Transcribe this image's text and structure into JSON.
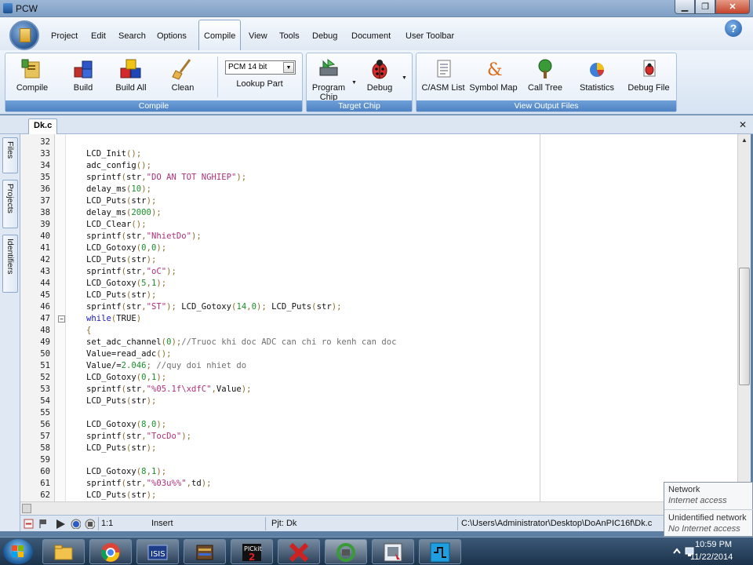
{
  "window": {
    "title": "PCW"
  },
  "menu": {
    "items": [
      "Project",
      "Edit",
      "Search",
      "Options",
      "Compile",
      "View",
      "Tools",
      "Debug",
      "Document",
      "User Toolbar"
    ],
    "active": "Compile",
    "help": "?"
  },
  "ribbon": {
    "compile_group": {
      "label": "Compile",
      "buttons": [
        "Compile",
        "Build",
        "Build All",
        "Clean"
      ],
      "chip_select_value": "PCM 14 bit",
      "lookup_part": "Lookup Part"
    },
    "target_group": {
      "label": "Target Chip",
      "program_chip_line1": "Program",
      "program_chip_line2": "Chip",
      "debug": "Debug"
    },
    "output_group": {
      "label": "View Output Files",
      "buttons": [
        "C/ASM List",
        "Symbol Map",
        "Call Tree",
        "Statistics",
        "Debug File"
      ]
    }
  },
  "editor": {
    "tab": "Dk.c",
    "side_tabs": [
      "Files",
      "Projects",
      "Identifiers"
    ],
    "lines": [
      {
        "n": "32",
        "code": ""
      },
      {
        "n": "33",
        "code": "LCD_Init();"
      },
      {
        "n": "34",
        "code": "adc_config();"
      },
      {
        "n": "35",
        "code": "sprintf(str,\"DO AN TOT NGHIEP\");"
      },
      {
        "n": "36",
        "code": "delay_ms(10);"
      },
      {
        "n": "37",
        "code": "LCD_Puts(str);"
      },
      {
        "n": "38",
        "code": "delay_ms(2000);"
      },
      {
        "n": "39",
        "code": "LCD_Clear();"
      },
      {
        "n": "40",
        "code": "sprintf(str,\"NhietDo\");"
      },
      {
        "n": "41",
        "code": "LCD_Gotoxy(0,0);"
      },
      {
        "n": "42",
        "code": "LCD_Puts(str);"
      },
      {
        "n": "43",
        "code": "sprintf(str,\"oC\");"
      },
      {
        "n": "44",
        "code": "LCD_Gotoxy(5,1);"
      },
      {
        "n": "45",
        "code": "LCD_Puts(str);"
      },
      {
        "n": "46",
        "code": "sprintf(str,\"ST\"); LCD_Gotoxy(14,0); LCD_Puts(str);"
      },
      {
        "n": "47",
        "code": "while(TRUE)"
      },
      {
        "n": "48",
        "code": "{"
      },
      {
        "n": "49",
        "code": "set_adc_channel(0);//Truoc khi doc ADC can chi ro kenh can doc"
      },
      {
        "n": "50",
        "code": "Value=read_adc();"
      },
      {
        "n": "51",
        "code": "Value/=2.046; //quy doi nhiet do"
      },
      {
        "n": "52",
        "code": "LCD_Gotoxy(0,1);"
      },
      {
        "n": "53",
        "code": "sprintf(str,\"%05.1f\\xdfC\",Value);"
      },
      {
        "n": "54",
        "code": "LCD_Puts(str);"
      },
      {
        "n": "55",
        "code": ""
      },
      {
        "n": "56",
        "code": "LCD_Gotoxy(8,0);"
      },
      {
        "n": "57",
        "code": "sprintf(str,\"TocDo\");"
      },
      {
        "n": "58",
        "code": "LCD_Puts(str);"
      },
      {
        "n": "59",
        "code": ""
      },
      {
        "n": "60",
        "code": "LCD_Gotoxy(8,1);"
      },
      {
        "n": "61",
        "code": "sprintf(str,\"%03u%%\",td);"
      },
      {
        "n": "62",
        "code": "LCD_Puts(str);"
      }
    ]
  },
  "status": {
    "position": "1:1",
    "mode": "Insert",
    "project": "Pjt: Dk",
    "path": "C:\\Users\\Administrator\\Desktop\\DoAnPIC16f\\Dk.c"
  },
  "network_popup": {
    "title1": "Network",
    "sub1": "Internet access",
    "title2": "Unidentified network",
    "sub2": "No Internet access"
  },
  "taskbar": {
    "items": [
      "explorer-icon",
      "chrome-icon",
      "isis-icon",
      "winrar-icon",
      "pickit2-icon",
      "proteus-icon",
      "pcw-icon",
      "app-icon",
      "circuit-icon"
    ],
    "time": "10:59 PM",
    "date": "11/22/2014"
  },
  "colors": {
    "keyword": "#1818c0",
    "string": "#b0307a",
    "number": "#1b8f2c",
    "comment": "#707070",
    "punct": "#8a6f2a"
  }
}
